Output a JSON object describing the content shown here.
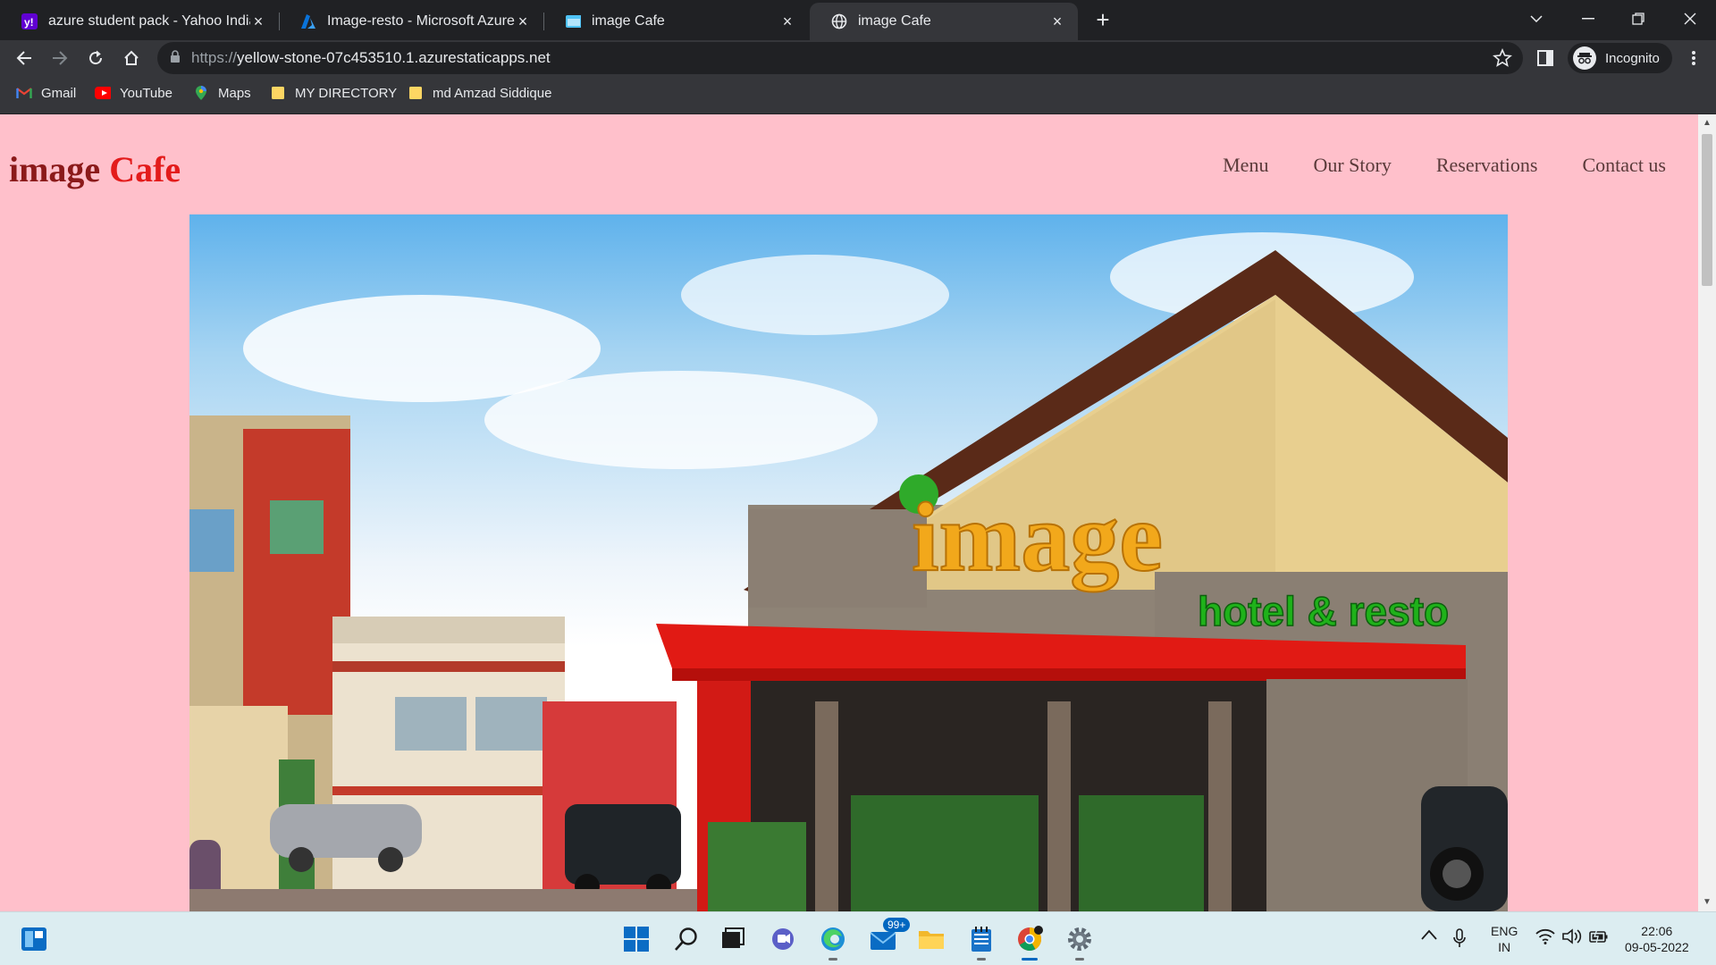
{
  "browser": {
    "tabs": [
      {
        "title": "azure student pack - Yahoo India",
        "favicon": "yahoo-icon",
        "active": false
      },
      {
        "title": "Image-resto - Microsoft Azure",
        "favicon": "azure-icon",
        "active": false
      },
      {
        "title": "image Cafe",
        "favicon": "folder-page-icon",
        "active": false
      },
      {
        "title": "image Cafe",
        "favicon": "globe-icon",
        "active": true
      }
    ],
    "url": {
      "scheme": "https://",
      "host": "yellow-stone-07c453510.1.azurestaticapps.net"
    },
    "profile_label": "Incognito",
    "bookmarks": [
      {
        "label": "Gmail",
        "icon": "gmail-icon"
      },
      {
        "label": "YouTube",
        "icon": "youtube-icon"
      },
      {
        "label": "Maps",
        "icon": "maps-icon"
      },
      {
        "label": "MY DIRECTORY",
        "icon": "folder-icon"
      },
      {
        "label": "md Amzad Siddique",
        "icon": "folder-icon"
      }
    ],
    "colors": {
      "frame": "#202124",
      "toolbar": "#35363a",
      "text": "#e8eaed"
    }
  },
  "site": {
    "logo_word1": "image",
    "logo_word2": "Cafe",
    "nav": [
      "Menu",
      "Our Story",
      "Reservations",
      "Contact us"
    ],
    "hero_sign_main": "image",
    "hero_sign_sub": "hotel & resto",
    "colors": {
      "background": "#ffc0cb",
      "logo": "#8b1a1a",
      "logo_accent": "#e31b1b"
    }
  },
  "taskbar": {
    "mail_badge": "99+",
    "language": "ENG",
    "region": "IN",
    "time": "22:06",
    "date": "09-05-2022"
  }
}
